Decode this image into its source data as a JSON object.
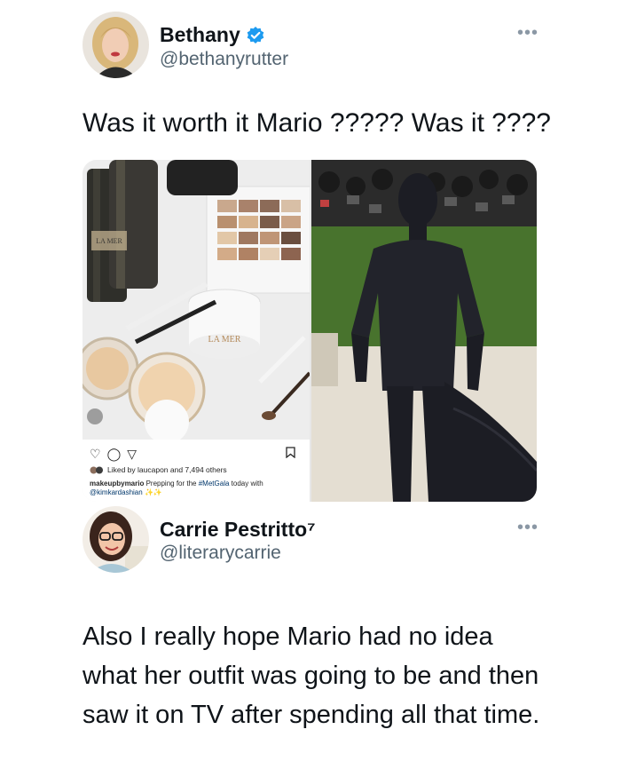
{
  "tweet1": {
    "display_name": "Bethany",
    "handle": "@bethanyrutter",
    "verified": true,
    "text": "Was it worth it Mario ????? Was it ????",
    "more_icon": "more-dots-icon"
  },
  "instagram": {
    "liked_text": "Liked by laucapon and 7,494 others",
    "caption_user": "makeupbymario",
    "caption_text": " Prepping for the ",
    "caption_hashtag": "#MetGala",
    "caption_text2": " today with",
    "caption_mention": "@kimkardashian",
    "caption_sparkles": "✨✨",
    "product_label": "LA MER"
  },
  "tweet2": {
    "display_name": "Carrie Pestritto⁷",
    "handle": "@literarycarrie",
    "text": "Also I really hope Mario had no idea what her outfit was going to be and then saw it on TV after spending all that time.",
    "more_icon": "more-dots-icon"
  },
  "colors": {
    "verified_blue": "#1d9bf0",
    "handle_gray": "#536471",
    "text": "#0f1419",
    "ig_link": "#00376b"
  }
}
